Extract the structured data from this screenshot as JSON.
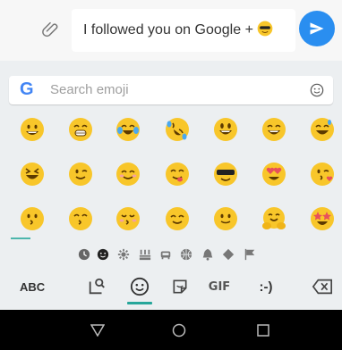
{
  "compose": {
    "message_text": "I followed you on Google +",
    "message_emoji_icon": "smiling-face-with-sunglasses-icon",
    "attach_icon": "paperclip-icon",
    "send_icon": "send-arrow-icon"
  },
  "keyboard": {
    "search": {
      "logo": "G",
      "placeholder": "Search emoji",
      "emoticon_icon": "smiley-outline-icon"
    },
    "emoji_rows": [
      [
        "grinning-face",
        "beaming-face-with-smiling-eyes",
        "face-with-tears-of-joy",
        "rolling-on-the-floor-laughing",
        "grinning-face-with-big-eyes",
        "grinning-face-with-smiling-eyes",
        "grinning-face-with-sweat"
      ],
      [
        "grinning-squinting-face",
        "winking-face",
        "smiling-face-with-smiling-eyes",
        "face-savoring-food",
        "smiling-face-with-sunglasses",
        "smiling-face-with-heart-eyes",
        "face-blowing-a-kiss"
      ],
      [
        "kissing-face",
        "kissing-face-with-smiling-eyes",
        "kissing-face-with-closed-eyes",
        "smiling-face",
        "slightly-smiling-face",
        "hugging-face",
        "star-struck"
      ]
    ],
    "categories": [
      "recent",
      "smileys",
      "animals-nature",
      "food-drink",
      "travel-places",
      "activities",
      "objects",
      "symbols",
      "flags"
    ],
    "bottom": {
      "abc_label": "ABC",
      "gif_label": "GIF",
      "emoticon_label": ":-)",
      "delete_icon": "backspace-icon"
    },
    "colors": {
      "accent": "#26a69a",
      "send": "#2a8ef0",
      "emoji_yellow": "#f8c62a"
    }
  },
  "navbar": {
    "back_icon": "back-triangle-icon",
    "home_icon": "home-circle-icon",
    "recents_icon": "recents-square-icon"
  }
}
